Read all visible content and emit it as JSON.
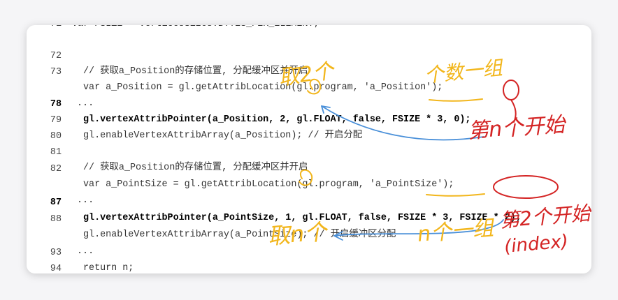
{
  "lines": [
    {
      "num": "71",
      "code": "var FSIZE = verticesSizes.BYTES_PER_ELEMENT;",
      "bold": false
    },
    {
      "num": "72",
      "code": "// 获取a_Position的存储位置, 分配缓冲区并开启",
      "bold": false
    },
    {
      "num": "73",
      "code": "var a_Position = gl.getAttribLocation(gl.program, 'a_Position');",
      "bold": false
    },
    {
      "num": "",
      "code": "...",
      "bold": false
    },
    {
      "num": "78",
      "code": "gl.vertexAttribPointer(a_Position, 2, gl.FLOAT, false, FSIZE * 3, 0);",
      "bold": true
    },
    {
      "num": "79",
      "code": "gl.enableVertexAttribArray(a_Position); // 开启分配",
      "bold": false
    },
    {
      "num": "80",
      "code": "",
      "bold": false
    },
    {
      "num": "81",
      "code": "// 获取a_Position的存储位置, 分配缓冲区并开启",
      "bold": false
    },
    {
      "num": "82",
      "code": "var a_PointSize = gl.getAttribLocation(gl.program, 'a_PointSize');",
      "bold": false
    },
    {
      "num": "",
      "code": "...",
      "bold": false
    },
    {
      "num": "87",
      "code": "gl.vertexAttribPointer(a_PointSize, 1, gl.FLOAT, false, FSIZE * 3, FSIZE * 2);",
      "bold": true
    },
    {
      "num": "88",
      "code": "gl.enableVertexAttribArray(a_PointSize); // 开启缓冲区分配",
      "bold": false
    },
    {
      "num": "",
      "code": "...",
      "bold": false
    },
    {
      "num": "93",
      "code": "return n;",
      "bold": false
    },
    {
      "num": "94",
      "code": "}",
      "bold": false
    }
  ],
  "annotations": {
    "take_two": "取2个",
    "group_of_n": "个数一组",
    "start_nth": "第n个开始",
    "take_n": "取n个",
    "n_group": "n个一组",
    "start_second": "第2个开始",
    "index": "(index)"
  },
  "colors": {
    "yellow": "#f2b61c",
    "red": "#d42424",
    "blue": "#4a90d9"
  }
}
